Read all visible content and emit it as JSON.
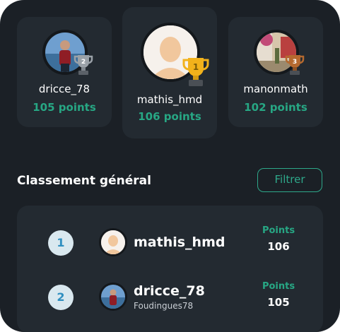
{
  "podium": [
    {
      "username": "dricce_78",
      "points": "105 points",
      "place": "2",
      "trophy": "silver-trophy-icon",
      "trophy_color": "#9aa1a8"
    },
    {
      "username": "mathis_hmd",
      "points": "106 points",
      "place": "1",
      "trophy": "gold-trophy-icon",
      "trophy_color": "#f2b21b"
    },
    {
      "username": "manonmath",
      "points": "102 points",
      "place": "3",
      "trophy": "bronze-trophy-icon",
      "trophy_color": "#b5692f"
    }
  ],
  "ranking": {
    "title": "Classement général",
    "filter_label": "Filtrer",
    "rows": [
      {
        "rank": "1",
        "username": "mathis_hmd",
        "subtitle": "",
        "points_label": "Points",
        "points": "106"
      },
      {
        "rank": "2",
        "username": "dricce_78",
        "subtitle": "Foudingues78",
        "points_label": "Points",
        "points": "105"
      }
    ]
  },
  "colors": {
    "background": "#1b2026",
    "card": "#232a31",
    "accent": "#27a784",
    "rank_badge_bg": "#d9e8ef",
    "rank_badge_text": "#2f8fc0"
  }
}
